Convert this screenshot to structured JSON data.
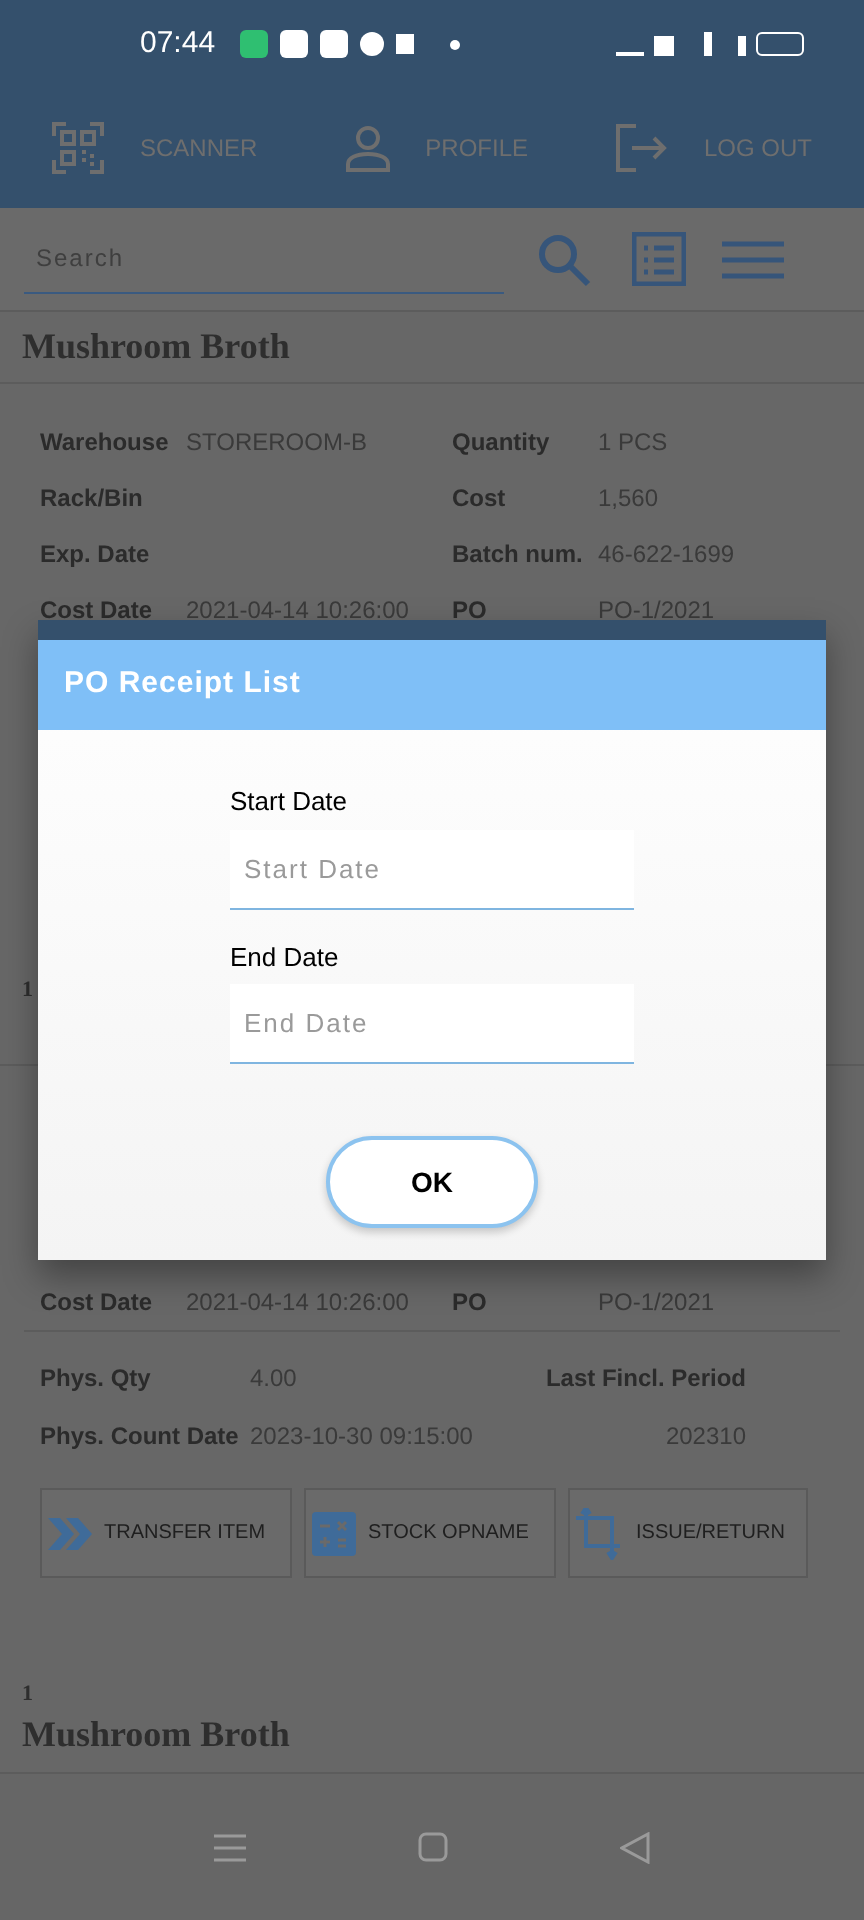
{
  "status_bar": {
    "time": "07:44"
  },
  "app_bar": {
    "items": [
      {
        "kind": "scanner",
        "label": "SCANNER"
      },
      {
        "kind": "profile",
        "label": "PROFILE"
      },
      {
        "kind": "logout",
        "label": "LOG OUT"
      }
    ]
  },
  "search": {
    "placeholder": "Search"
  },
  "first_item": {
    "title": "Mushroom Broth",
    "fields": [
      {
        "label": "Warehouse",
        "value": "STOREROOM-B",
        "label_2": "Quantity",
        "value_2": "1 PCS"
      },
      {
        "label": "Rack/Bin",
        "label_2": "Cost",
        "value_2": "1,560"
      },
      {
        "label": "Exp. Date",
        "label_2": "Batch num.",
        "value_2": "46-622-1699"
      },
      {
        "label": "Cost Date",
        "value": "2021-04-14 10:26:00",
        "label_2": "PO",
        "value_2": "PO-1/2021"
      }
    ]
  },
  "second_item": {
    "number": "1",
    "cost_row": {
      "label": "Cost Date",
      "value": "2021-04-14 10:26:00",
      "label_2": "PO",
      "value_2": "PO-1/2021"
    },
    "phys_rows": [
      {
        "label": "Phys. Qty",
        "value": "4.00",
        "label_2": "Last Fincl. Period"
      },
      {
        "label": "Phys. Count Date",
        "value": "2023-10-30 09:15:00",
        "value_2": "202310"
      }
    ],
    "actions": [
      {
        "kind": "transfer",
        "label": "TRANSFER ITEM"
      },
      {
        "kind": "opname",
        "label": "STOCK OPNAME"
      },
      {
        "kind": "issue",
        "label": "ISSUE/RETURN"
      }
    ]
  },
  "third_item": {
    "number": "1",
    "title": "Mushroom Broth"
  },
  "dialog": {
    "title": "PO Receipt List",
    "fields": [
      {
        "label": "Start Date",
        "placeholder": "Start Date"
      },
      {
        "label": "End Date",
        "placeholder": "End Date"
      }
    ],
    "button": "OK"
  }
}
